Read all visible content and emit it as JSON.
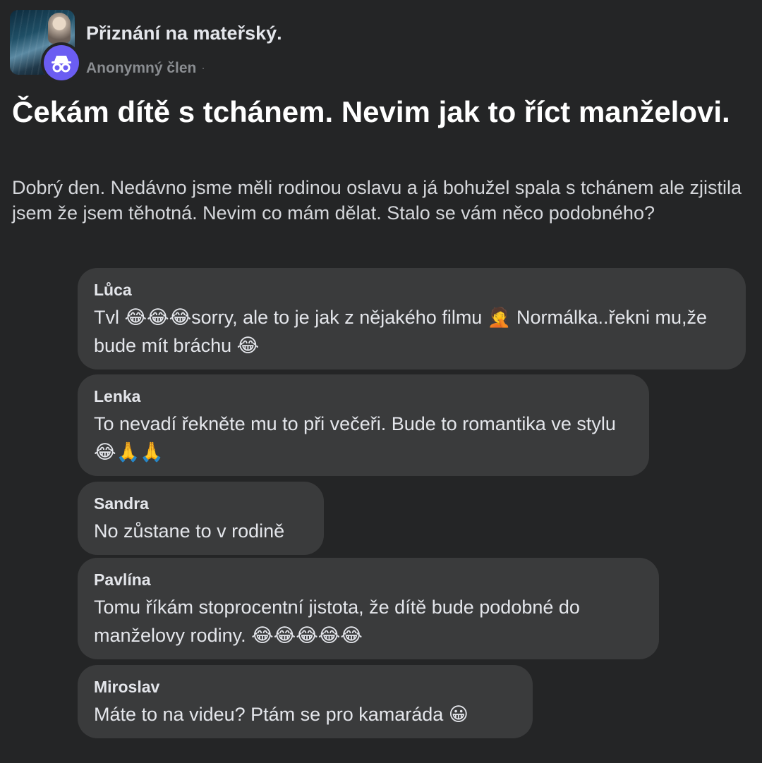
{
  "group": {
    "name": "Přiznání na mateřský.",
    "author": "Anonymný člen",
    "author_suffix": "·"
  },
  "icons": {
    "avatar": "anonymous-incognito-icon",
    "group_thumbnail": "group-cover-image"
  },
  "colors": {
    "background": "#242526",
    "bubble": "#3a3b3c",
    "avatar_accent": "#6b5df2",
    "muted_text": "#8a8d91"
  },
  "post": {
    "title": "Čekám dítě s tchánem. Nevim jak to říct manželovi.",
    "body": "Dobrý den. Nedávno jsme měli rodinou oslavu a já bohužel spala s tchánem ale zjistila jsem že jsem těhotná. Nevim co mám dělat. Stalo se vám něco podobného?"
  },
  "comments": [
    {
      "author": "Lůca",
      "text": "Tvl 😂😂😂sorry, ale to je jak z nějakého filmu 🤦 Normálka..řekni mu,že bude mít bráchu 😂"
    },
    {
      "author": "Lenka",
      "text": "To nevadí řekněte mu to při večeři. Bude to romantika  ve stylu😂🙏🙏"
    },
    {
      "author": "Sandra",
      "text": "No zůstane to v rodině"
    },
    {
      "author": "Pavlína",
      "text": "Tomu říkám stoprocentní jistota, že dítě bude podobné do manželovy rodiny. 😂😂😂😂😂"
    },
    {
      "author": "Miroslav",
      "text": "Máte to na videu? Ptám se pro kamaráda 😀"
    }
  ]
}
